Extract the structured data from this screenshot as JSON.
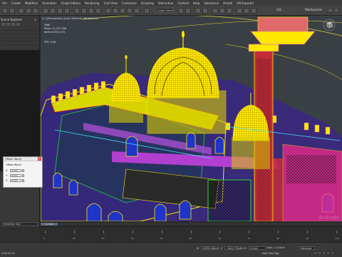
{
  "menu": [
    "File",
    "Create",
    "Modifiers",
    "Animation",
    "Graph Editors",
    "Rendering",
    "Civil View",
    "Customize",
    "Scripting",
    "Interactive",
    "Content",
    "Help",
    "Substance",
    "Arnold",
    "LM Exporter"
  ],
  "toolbar": {
    "selection_set_dropdown": "Create Selection Set",
    "workspace_label": "LUL",
    "workspace_value": "Workspaces"
  },
  "scene_explorer": {
    "title": "Scene Explorer"
  },
  "viewport": {
    "label": "[+] [Perspective] [User Defined] [Wireframe]",
    "stats": {
      "header": "Total",
      "polys_label": "Polys:",
      "polys_value": "11,327,306",
      "verts_label": "Verts:",
      "verts_value": "6,913,170"
    },
    "fps_label": "FPS:",
    "fps_value": "0.00",
    "watermark": "Activate"
  },
  "offset_dialog": {
    "title": "Offset: World",
    "group_label": "Offset:World",
    "rows": [
      {
        "axis": "X",
        "value": "0.0cm"
      },
      {
        "axis": "Y",
        "value": "0.0cm"
      },
      {
        "axis": "Z",
        "value": "0.0cm"
      }
    ]
  },
  "selection_set": "Selection Set:",
  "timeline": {
    "slider_label": "0 / 100",
    "ticks": [
      "0",
      "10",
      "20",
      "30",
      "40",
      "50",
      "60",
      "70",
      "80",
      "90",
      "100"
    ]
  },
  "status": {
    "frame": "0:00:20:00",
    "x_label": "X:",
    "x_value": "1878.249cm",
    "y_label": "Y:",
    "y_value": "-3441.723cm",
    "z_label": "Z:",
    "z_value": "0.0cm",
    "grid": "Grid = 10.0cm",
    "add_time_tag": "Add Time Tag",
    "set_key": "Selected"
  }
}
